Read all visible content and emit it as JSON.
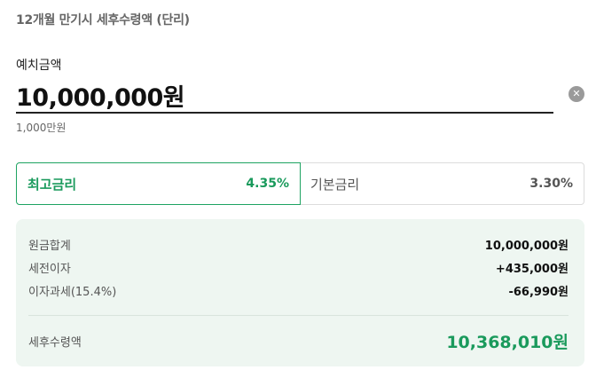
{
  "header": {
    "title": "12개월 만기시 세후수령액 (단리)"
  },
  "deposit": {
    "label": "예치금액",
    "value": "10,000,000원",
    "hint": "1,000만원",
    "clear_icon": "close-circle-icon"
  },
  "rates": {
    "max": {
      "label": "최고금리",
      "value": "4.35%"
    },
    "base": {
      "label": "기본금리",
      "value": "3.30%"
    }
  },
  "summary": {
    "rows": [
      {
        "label": "원금합계",
        "value": "10,000,000원"
      },
      {
        "label": "세전이자",
        "value": "+435,000원"
      },
      {
        "label": "이자과세(15.4%)",
        "value": "-66,990원"
      }
    ],
    "total": {
      "label": "세후수령액",
      "value": "10,368,010원"
    }
  },
  "colors": {
    "accent": "#1a9a5c",
    "summary_bg": "#eef6f1",
    "border": "#dcdcdc"
  }
}
